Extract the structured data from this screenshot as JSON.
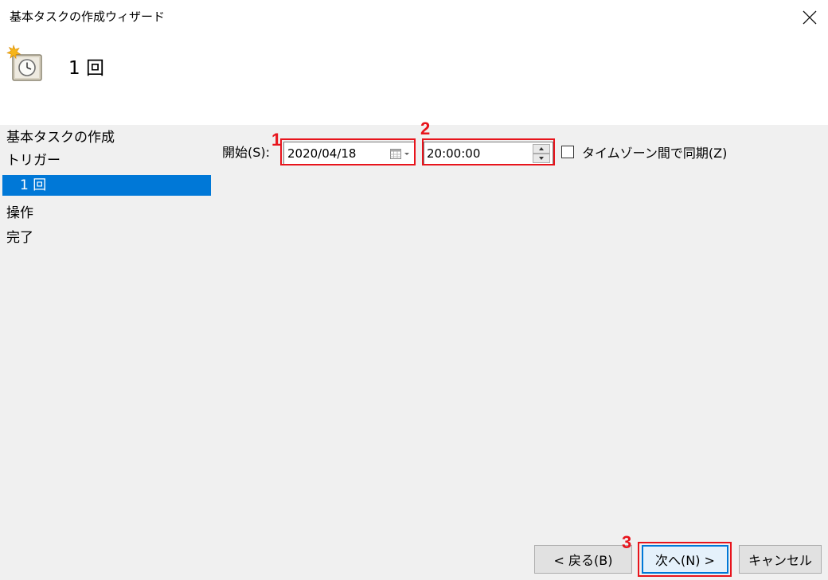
{
  "window": {
    "title": "基本タスクの作成ウィザード"
  },
  "header": {
    "title": "1 回",
    "icon": "task-clock-icon"
  },
  "sidebar": {
    "items": [
      {
        "label": "基本タスクの作成"
      },
      {
        "label": "トリガー"
      },
      {
        "label": "1 回",
        "selected": true
      },
      {
        "label": "操作"
      },
      {
        "label": "完了"
      }
    ]
  },
  "form": {
    "start_label": "開始(S):",
    "date_value": "2020/04/18",
    "time_value": "20:00:00",
    "timezone_sync_label": "タイムゾーン間で同期(Z)",
    "timezone_sync_checked": false
  },
  "annotations": {
    "one": "1",
    "two": "2",
    "three": "3",
    "color": "#e8141c"
  },
  "buttons": {
    "back": "< 戻る(B)",
    "next": "次へ(N) >",
    "cancel": "キャンセル"
  },
  "colors": {
    "selection": "#0078d7",
    "panel": "#f0f0f0"
  }
}
